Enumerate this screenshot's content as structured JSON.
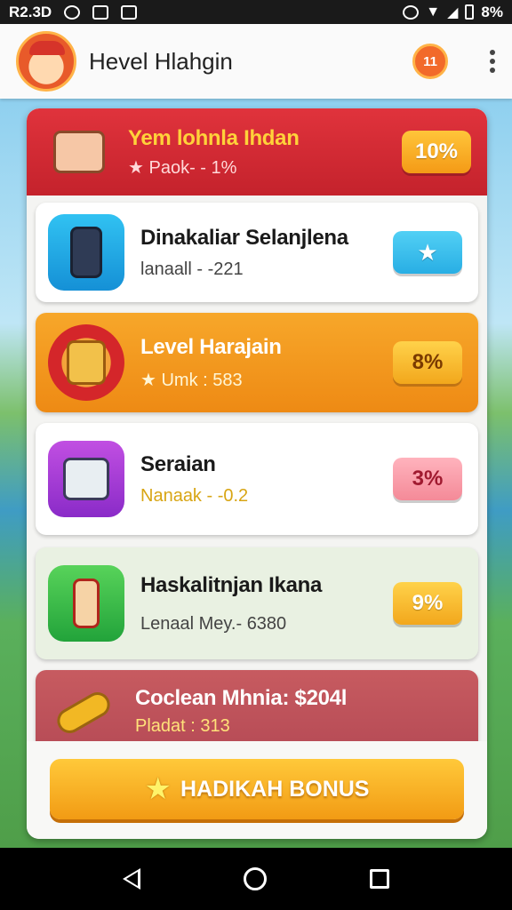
{
  "status_bar": {
    "time": "R2.3D",
    "battery": "8%"
  },
  "app_bar": {
    "title": "Hevel Hlahgin",
    "notification_count": "11"
  },
  "rows": [
    {
      "title": "Yem lohnla Ihdan",
      "subtitle": "★ Paok- - 1%",
      "value": "10%",
      "icon": "gift-box-icon"
    },
    {
      "title": "Dinakaliar Selanjlena",
      "subtitle": "lanaall - -221",
      "value": "★",
      "icon": "phone-icon"
    },
    {
      "title": "Level Harajain",
      "subtitle": "★ Umk : 583",
      "value": "8%",
      "icon": "camera-icon"
    },
    {
      "title": "Seraian",
      "subtitle": "Nanaak - -0.2",
      "value": "3%",
      "icon": "photo-frame-icon"
    },
    {
      "title": "Haskalitnjan Ikana",
      "subtitle": "Lenaal Mey.- 6380",
      "value": "9%",
      "icon": "bottle-icon"
    },
    {
      "title": "Coclean Mhnia: $204l",
      "subtitle": "Pladat : 313",
      "icon": "ticket-icon"
    }
  ],
  "bonus_button": {
    "label": "HADIKAH BONUS"
  },
  "colors": {
    "header_red": "#d42a33",
    "accent_orange": "#f29b14",
    "highlight_yellow": "#ffd23a",
    "cyan_pill": "#28aee4",
    "pink_pill": "#f48a98"
  }
}
